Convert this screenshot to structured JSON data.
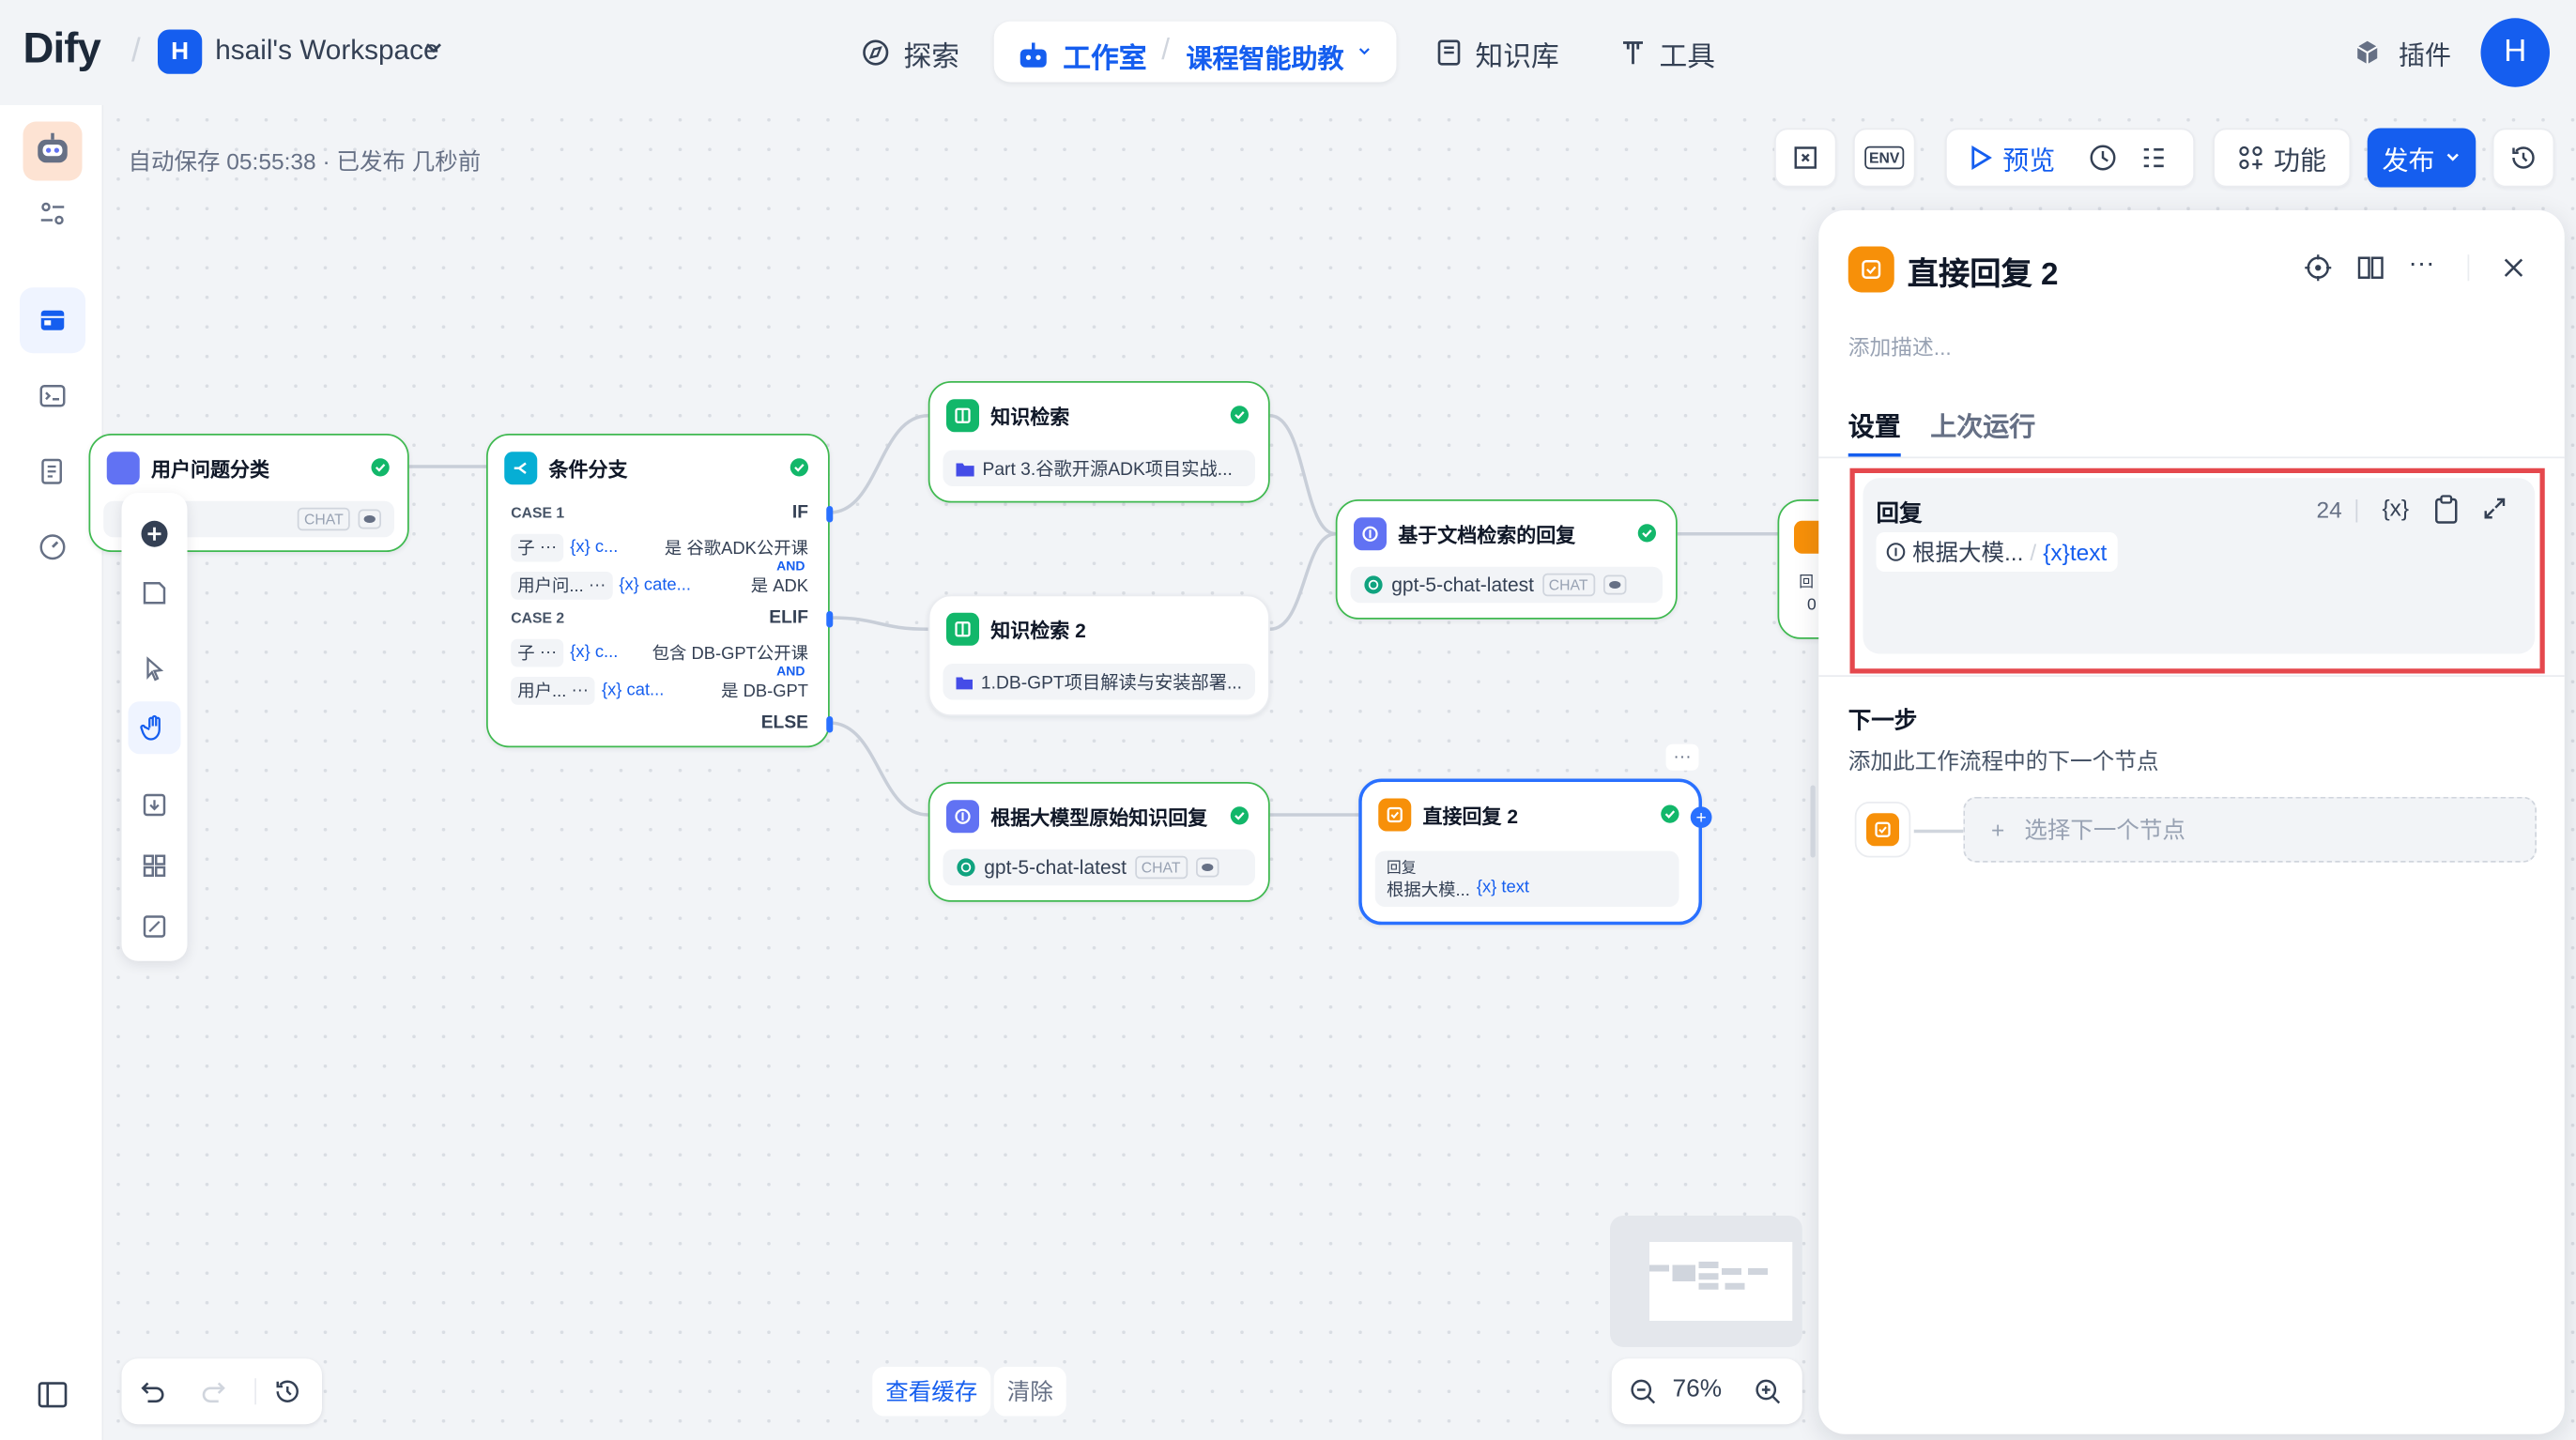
{
  "brand": {
    "logo": "Dify",
    "workspace_initial": "H",
    "workspace_name": "hsail's Workspace"
  },
  "nav": {
    "explore": "探索",
    "studio": "工作室",
    "app_name": "课程智能助教",
    "knowledge": "知识库",
    "tools": "工具",
    "plugins": "插件",
    "user_initial": "H"
  },
  "status": "自动保存 05:55:38 · 已发布 几秒前",
  "toolbar": {
    "preview": "预览",
    "features": "功能",
    "publish": "发布",
    "env": "ENV"
  },
  "nodes": {
    "classifier": {
      "title": "用户问题分类",
      "chat": "CHAT"
    },
    "ifelse": {
      "title": "条件分支",
      "case1": "CASE 1",
      "if": "IF",
      "c1_row1_a": "子",
      "c1_row1_dots": "···",
      "c1_row1_var": "c...",
      "c1_row1_op": "是 谷歌ADK公开课",
      "and": "AND",
      "c1_row2_a": "用户问...",
      "c1_row2_dots": "···",
      "c1_row2_var": "cate...",
      "c1_row2_op": "是 ADK",
      "case2": "CASE 2",
      "elif": "ELIF",
      "c2_row1_a": "子",
      "c2_row1_dots": "···",
      "c2_row1_var": "c...",
      "c2_row1_op": "包含 DB-GPT公开课",
      "c2_row2_a": "用户...",
      "c2_row2_dots": "···",
      "c2_row2_var": "cat...",
      "c2_row2_op": "是 DB-GPT",
      "else": "ELSE"
    },
    "kr1": {
      "title": "知识检索",
      "dataset": "Part 3.谷歌开源ADK项目实战..."
    },
    "kr2": {
      "title": "知识检索 2",
      "dataset": "1.DB-GPT项目解读与安装部署..."
    },
    "llm_doc": {
      "title": "基于文档检索的回复",
      "model": "gpt-5-chat-latest",
      "chat": "CHAT"
    },
    "llm_raw": {
      "title": "根据大模型原始知识回复",
      "model": "gpt-5-chat-latest",
      "chat": "CHAT"
    },
    "answer2": {
      "title": "直接回复 2",
      "label": "回复",
      "ref": "根据大模...",
      "var": "text"
    },
    "partial": {
      "label": "回",
      "ref": "0"
    }
  },
  "panel": {
    "title": "直接回复 2",
    "description_placeholder": "添加描述...",
    "tab_settings": "设置",
    "tab_last_run": "上次运行",
    "reply_label": "回复",
    "reply_count": "24",
    "reply_ref": "根据大模...",
    "reply_var": "text",
    "var_token": "{x}",
    "next_title": "下一步",
    "next_desc": "添加此工作流程中的下一个节点",
    "next_select": "选择下一个节点"
  },
  "bottom": {
    "view_cache": "查看缓存",
    "clear": "清除",
    "zoom": "76%"
  },
  "colors": {
    "accent": "#155eef",
    "success": "#12b76a",
    "answer": "#f79009",
    "highlight": "#e5484d"
  }
}
